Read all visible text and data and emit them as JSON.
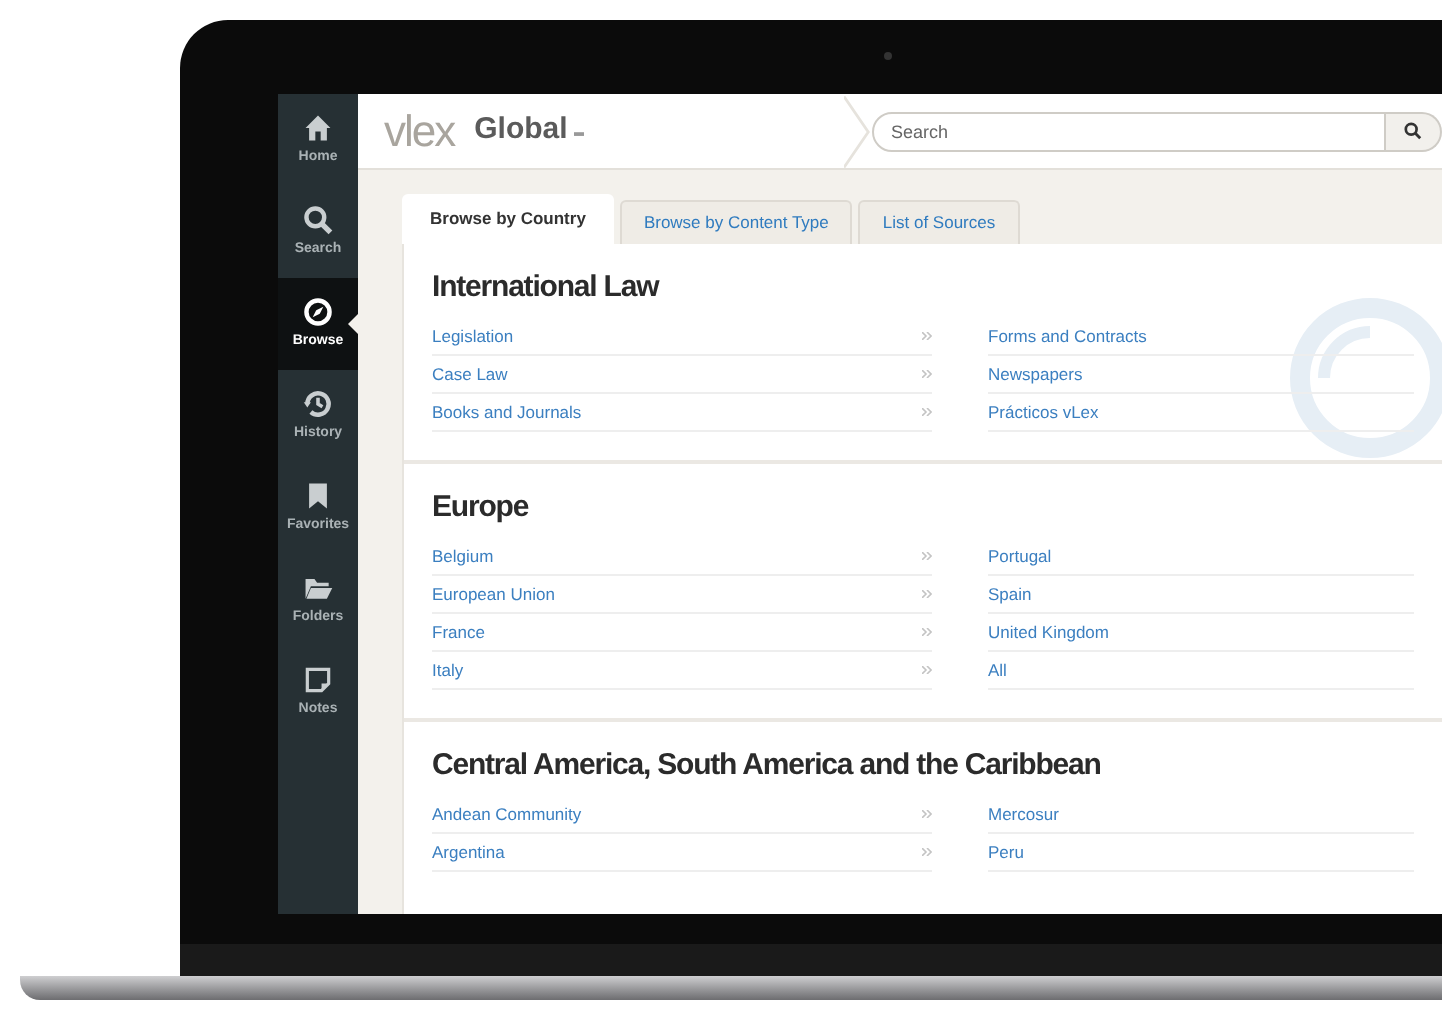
{
  "sidebar": {
    "items": [
      {
        "kind": "home",
        "label": "Home",
        "selected": false
      },
      {
        "kind": "search",
        "label": "Search",
        "selected": false
      },
      {
        "kind": "browse",
        "label": "Browse",
        "selected": true
      },
      {
        "kind": "history",
        "label": "History",
        "selected": false
      },
      {
        "kind": "favorites",
        "label": "Favorites",
        "selected": false
      },
      {
        "kind": "folders",
        "label": "Folders",
        "selected": false
      },
      {
        "kind": "notes",
        "label": "Notes",
        "selected": false
      }
    ]
  },
  "header": {
    "logo": "vlex",
    "site": "Global",
    "search": {
      "placeholder": "Search"
    }
  },
  "tabs": [
    {
      "label": "Browse by Country",
      "selected": true
    },
    {
      "label": "Browse by Content Type",
      "selected": false
    },
    {
      "label": "List of Sources",
      "selected": false
    }
  ],
  "sections": [
    {
      "title": "International Law",
      "rows": [
        {
          "left": "Legislation",
          "right": "Forms and Contracts"
        },
        {
          "left": "Case Law",
          "right": "Newspapers"
        },
        {
          "left": "Books and Journals",
          "right": "Prácticos vLex"
        }
      ]
    },
    {
      "title": "Europe",
      "rows": [
        {
          "left": "Belgium",
          "right": "Portugal"
        },
        {
          "left": "European Union",
          "right": "Spain"
        },
        {
          "left": "France",
          "right": "United Kingdom"
        },
        {
          "left": "Italy",
          "right": "All"
        }
      ]
    },
    {
      "title": "Central America, South America and the Caribbean",
      "rows": [
        {
          "left": "Andean Community",
          "right": "Mercosur"
        },
        {
          "left": "Argentina",
          "right": "Peru"
        }
      ]
    }
  ]
}
